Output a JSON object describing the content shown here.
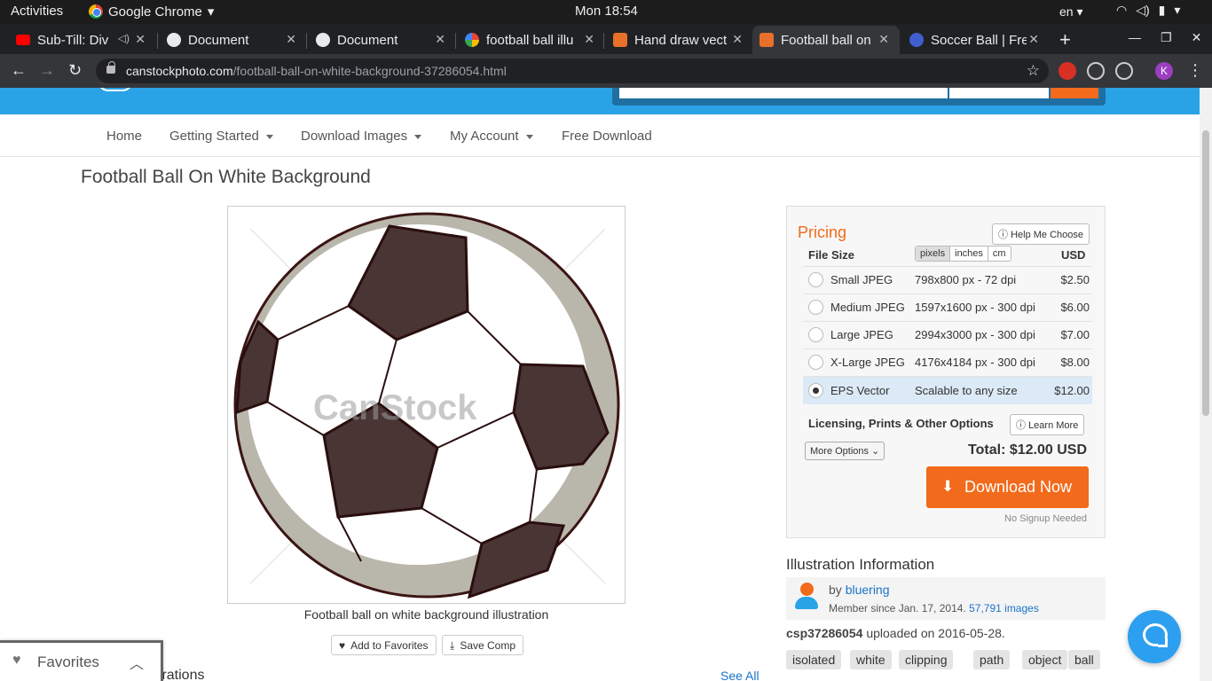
{
  "system": {
    "activities": "Activities",
    "app_name": "Google Chrome",
    "clock": "Mon 18:54",
    "lang": "en"
  },
  "tabs": [
    {
      "title": "Sub-Till: Div",
      "icon": "youtube-icon"
    },
    {
      "title": "Document",
      "icon": "document-icon"
    },
    {
      "title": "Document",
      "icon": "document-icon"
    },
    {
      "title": "football ball illu",
      "icon": "google-icon"
    },
    {
      "title": "Hand draw vect",
      "icon": "canstock-icon"
    },
    {
      "title": "Football ball on",
      "icon": "canstock-icon"
    },
    {
      "title": "Soccer Ball | Fre",
      "icon": "soccer-icon"
    }
  ],
  "address_bar": {
    "domain": "canstockphoto.com",
    "path": "/football-ball-on-white-background-37286054.html",
    "profile_initial": "K"
  },
  "nav": {
    "home": "Home",
    "getting_started": "Getting Started",
    "download_images": "Download Images",
    "my_account": "My Account",
    "free_download": "Free Download"
  },
  "page_title": "Football Ball On White Background",
  "image": {
    "watermark": "CanStock",
    "caption": "Football ball on white background illustration",
    "add_to_favorites": "Add to Favorites",
    "save_comp": "Save Comp"
  },
  "pricing": {
    "title": "Pricing",
    "help_me_choose": "Help Me Choose",
    "file_size_label": "File Size",
    "units": [
      "pixels",
      "inches",
      "cm"
    ],
    "selected_unit": "pixels",
    "currency": "USD",
    "rows": [
      {
        "name": "Small JPEG",
        "size": "798x800 px - 72 dpi",
        "price": "$2.50"
      },
      {
        "name": "Medium JPEG",
        "size": "1597x1600 px - 300 dpi",
        "price": "$6.00"
      },
      {
        "name": "Large JPEG",
        "size": "2994x3000 px - 300 dpi",
        "price": "$7.00"
      },
      {
        "name": "X-Large JPEG",
        "size": "4176x4184 px - 300 dpi",
        "price": "$8.00"
      },
      {
        "name": "EPS Vector",
        "size": "Scalable to any size",
        "price": "$12.00"
      }
    ],
    "selected_row": "EPS Vector",
    "licensing_label": "Licensing, Prints & Other Options",
    "learn_more": "Learn More",
    "more_options": "More Options",
    "total": "Total: $12.00 USD",
    "download_now": "Download Now",
    "no_signup": "No Signup Needed"
  },
  "illustration_info": {
    "title": "Illustration Information",
    "by": "by",
    "author": "bluering",
    "member_since": "Member since Jan. 17, 2014.",
    "image_count": "57,791 images",
    "id": "csp37286054",
    "uploaded": "uploaded on 2016-05-28.",
    "tags": [
      "isolated",
      "white",
      "clipping",
      "path",
      "object",
      "ball"
    ]
  },
  "related": {
    "heading_partial": "strations",
    "see_all": "See All"
  },
  "favorites_panel": {
    "label": "Favorites"
  },
  "colors": {
    "brand_blue": "#2aa3e6",
    "accent_orange": "#f26a1b",
    "link_blue": "#1a73c8"
  }
}
